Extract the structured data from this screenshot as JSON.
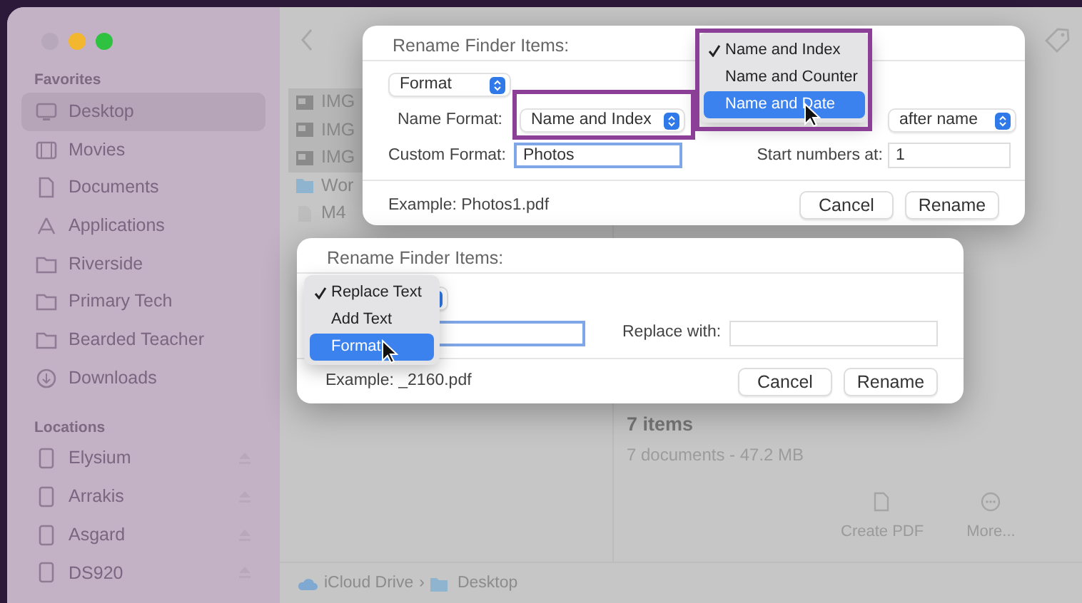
{
  "sidebar": {
    "sections": [
      {
        "heading": "Favorites",
        "items": [
          {
            "label": "Desktop",
            "kind": "desktop",
            "selected": true,
            "ejectable": false
          },
          {
            "label": "Movies",
            "kind": "movies",
            "selected": false,
            "ejectable": false
          },
          {
            "label": "Documents",
            "kind": "document",
            "selected": false,
            "ejectable": false
          },
          {
            "label": "Applications",
            "kind": "apps",
            "selected": false,
            "ejectable": false
          },
          {
            "label": "Riverside",
            "kind": "folder",
            "selected": false,
            "ejectable": false
          },
          {
            "label": "Primary Tech",
            "kind": "folder",
            "selected": false,
            "ejectable": false
          },
          {
            "label": "Bearded Teacher",
            "kind": "folder",
            "selected": false,
            "ejectable": false
          },
          {
            "label": "Downloads",
            "kind": "download",
            "selected": false,
            "ejectable": false
          }
        ]
      },
      {
        "heading": "Locations",
        "items": [
          {
            "label": "Elysium",
            "kind": "drive",
            "selected": false,
            "ejectable": true
          },
          {
            "label": "Arrakis",
            "kind": "drive",
            "selected": false,
            "ejectable": true
          },
          {
            "label": "Asgard",
            "kind": "drive",
            "selected": false,
            "ejectable": true
          },
          {
            "label": "DS920",
            "kind": "drive",
            "selected": false,
            "ejectable": true
          }
        ]
      }
    ]
  },
  "files": [
    {
      "name": "IMG",
      "kind": "image",
      "selected": true
    },
    {
      "name": "IMG",
      "kind": "image",
      "selected": true
    },
    {
      "name": "IMG",
      "kind": "image",
      "selected": true
    },
    {
      "name": "Wor",
      "kind": "folder",
      "selected": false
    },
    {
      "name": "M4",
      "kind": "document",
      "selected": false
    }
  ],
  "summary": {
    "title": "7 items",
    "detail": "7 documents - 47.2 MB",
    "actions": [
      {
        "label": "Create PDF",
        "kind": "pdf"
      },
      {
        "label": "More...",
        "kind": "more"
      }
    ]
  },
  "path_bar": {
    "separator": "›",
    "items": [
      {
        "label": "iCloud Drive",
        "kind": "cloud"
      },
      {
        "label": "Desktop",
        "kind": "folder"
      }
    ]
  },
  "format_dialog": {
    "title": "Rename Finder Items:",
    "mode": "Format",
    "name_format_label": "Name Format:",
    "name_format": "Name and Index",
    "position": "after name",
    "custom_format_label": "Custom Format:",
    "custom_format": "Photos",
    "start_label": "Start numbers at:",
    "start_value": "1",
    "example": "Example: Photos1.pdf",
    "buttons": [
      "Cancel",
      "Rename"
    ]
  },
  "name_format_menu": {
    "items": [
      {
        "label": "Name and Index",
        "checked": true,
        "selected": false
      },
      {
        "label": "Name and Counter",
        "checked": false,
        "selected": false
      },
      {
        "label": "Name and Date",
        "checked": false,
        "selected": true
      }
    ]
  },
  "replace_dialog": {
    "title": "Rename Finder Items:",
    "replace_label": "Replace with:",
    "example": "Example: _2160.pdf",
    "buttons": [
      "Cancel",
      "Rename"
    ]
  },
  "mode_menu": {
    "items": [
      {
        "label": "Replace Text",
        "checked": true,
        "selected": false
      },
      {
        "label": "Add Text",
        "checked": false,
        "selected": false
      },
      {
        "label": "Format",
        "checked": false,
        "selected": true
      }
    ]
  }
}
